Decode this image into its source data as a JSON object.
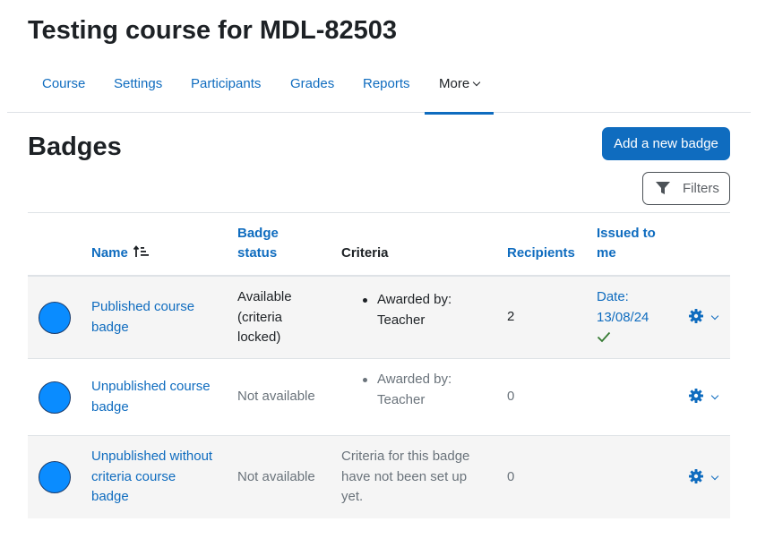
{
  "course_title": "Testing course for MDL-82503",
  "nav": {
    "tabs": [
      "Course",
      "Settings",
      "Participants",
      "Grades",
      "Reports"
    ],
    "more_label": "More"
  },
  "page_heading": "Badges",
  "add_badge_label": "Add a new badge",
  "filters_label": "Filters",
  "table": {
    "headers": {
      "name": "Name",
      "status_line1": "Badge",
      "status_line2": "status",
      "criteria": "Criteria",
      "recipients": "Recipients",
      "issued_line1": "Issued to",
      "issued_line2": "me"
    },
    "rows": [
      {
        "name_line1": "Published course",
        "name_line2": "badge",
        "status_line1": "Available",
        "status_line2": "(criteria",
        "status_line3": "locked)",
        "criteria_line1": "Awarded by:",
        "criteria_line2": "Teacher",
        "recipients": "2",
        "issued_line1": "Date:",
        "issued_line2": "13/08/24"
      },
      {
        "name_line1": "Unpublished course",
        "name_line2": "badge",
        "status": "Not available",
        "criteria_line1": "Awarded by:",
        "criteria_line2": "Teacher",
        "recipients": "0"
      },
      {
        "name_line1": "Unpublished without",
        "name_line2": "criteria course",
        "name_line3": "badge",
        "status": "Not available",
        "criteria_line1": "Criteria for this badge",
        "criteria_line2": "have not been set up",
        "criteria_line3": "yet.",
        "recipients": "0"
      }
    ]
  },
  "colors": {
    "accent": "#0f6cbf",
    "badge_fill": "#0a8cff",
    "check": "#357a32",
    "row_alt": "#f5f5f5"
  },
  "icons": {
    "sort": "sort-ascending-icon",
    "filter": "filter-funnel-icon",
    "actions": "gear-icon",
    "issued": "checkmark-icon"
  }
}
